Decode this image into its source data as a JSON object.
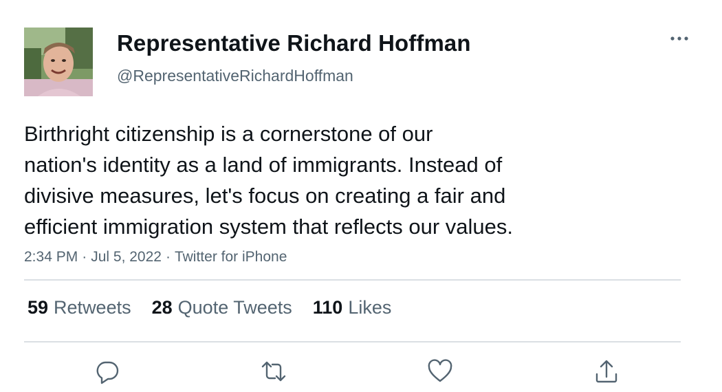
{
  "author": {
    "display_name": "Representative Richard Hoffman",
    "handle": "@RepresentativeRichardHoffman"
  },
  "tweet": {
    "lines": [
      "Birthright citizenship is a cornerstone of our",
      "nation's identity as a land of immigrants. Instead of",
      "divisive measures, let's focus on creating a fair and",
      "efficient immigration system that reflects our values."
    ],
    "time": "2:34 PM",
    "date": "Jul 5, 2022",
    "source": "Twitter for iPhone",
    "separator": "·"
  },
  "stats": {
    "retweets_count": "59",
    "retweets_label": "Retweets",
    "quotes_count": "28",
    "quotes_label": "Quote Tweets",
    "likes_count": "110",
    "likes_label": "Likes"
  },
  "icons": {
    "more": "more-horizontal-icon",
    "reply": "reply-icon",
    "retweet": "retweet-icon",
    "like": "like-icon",
    "share": "share-icon"
  },
  "colors": {
    "text": "#0f1419",
    "secondary": "#536471",
    "divider": "#dadfe3"
  }
}
